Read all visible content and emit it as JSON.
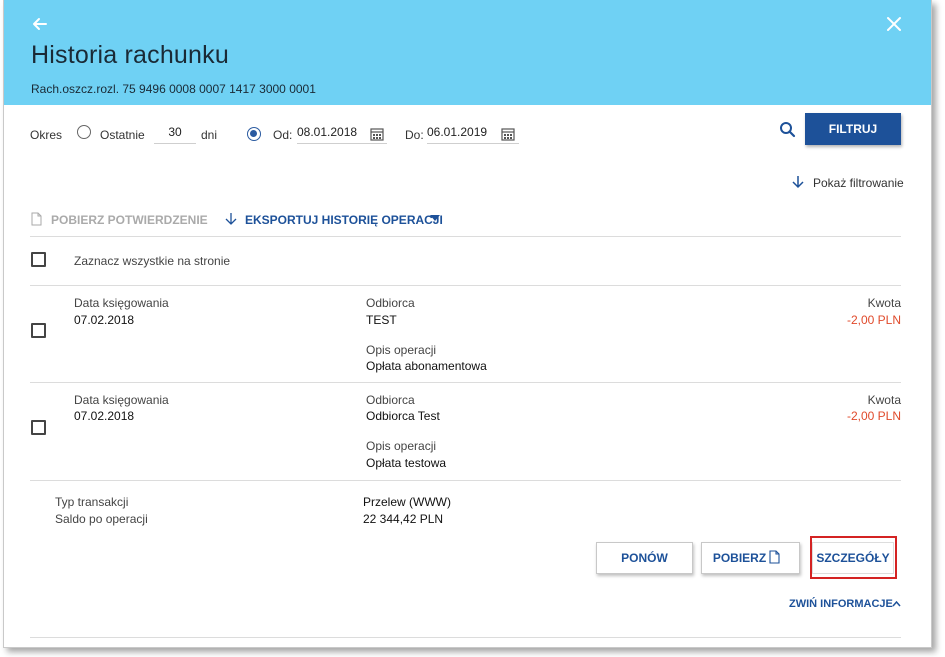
{
  "header": {
    "title": "Historia rachunku",
    "account": "Rach.oszcz.rozl. 75 9496 0008 0007 1417 3000 0001",
    "back_icon": "arrow-left-icon",
    "close_icon": "close-icon",
    "bg_color": "#6fd1f4"
  },
  "filter": {
    "period_label": "Okres",
    "last_label": "Ostatnie",
    "last_value": "30",
    "days_label": "dni",
    "from_label": "Od:",
    "from_value": "08.01.2018",
    "to_label": "Do:",
    "to_value": "06.01.2019",
    "selected_option": "date-range",
    "filter_button": "FILTRUJ",
    "show_filtering": "Pokaż filtrowanie"
  },
  "toolbar": {
    "download_confirmation": "POBIERZ POTWIERDZENIE",
    "export_history": "EKSPORTUJ HISTORIĘ OPERACJI"
  },
  "select_all": "Zaznacz wszystkie na stronie",
  "transactions": [
    {
      "date_label": "Data księgowania",
      "date": "07.02.2018",
      "recipient_label": "Odbiorca",
      "recipient": "TEST",
      "desc_label": "Opis operacji",
      "desc": "Opłata abonamentowa",
      "amount_label": "Kwota",
      "amount": "-2,00  PLN"
    },
    {
      "date_label": "Data księgowania",
      "date": "07.02.2018",
      "recipient_label": "Odbiorca",
      "recipient": "Odbiorca Test",
      "desc_label": "Opis operacji",
      "desc": "Opłata testowa",
      "amount_label": "Kwota",
      "amount": "-2,00  PLN"
    }
  ],
  "details": {
    "type_label": "Typ transakcji",
    "type_value": "Przelew (WWW)",
    "balance_label": "Saldo po operacji",
    "balance_value": "22 344,42  PLN",
    "repeat_button": "PONÓW",
    "download_button": "POBIERZ",
    "details_button": "SZCZEGÓŁY",
    "collapse_link": "ZWIŃ INFORMACJE"
  },
  "colors": {
    "accent": "#1d5199",
    "negative": "#e04a2b",
    "highlight": "#d42323"
  }
}
